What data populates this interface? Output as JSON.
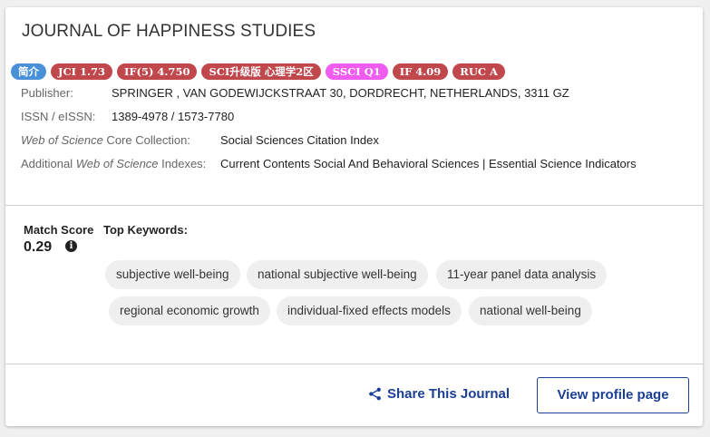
{
  "journal": {
    "title": "JOURNAL OF HAPPINESS STUDIES",
    "badges": [
      {
        "text": "简介",
        "color": "#4a90d9"
      },
      {
        "text": "JCI 1.73",
        "color": "#c0474b"
      },
      {
        "text": "IF(5) 4.750",
        "color": "#c0474b"
      },
      {
        "text": "SCI升级版 心理学2区",
        "color": "#c0474b"
      },
      {
        "text": "SSCI Q1",
        "color": "#f05bf0"
      },
      {
        "text": "IF 4.09",
        "color": "#c0474b"
      },
      {
        "text": "RUC A",
        "color": "#c0474b"
      }
    ],
    "publisher_label": "Publisher:",
    "publisher": "SPRINGER , VAN GODEWIJCKSTRAAT 30, DORDRECHT, NETHERLANDS, 3311 GZ",
    "issn_label": "ISSN / eISSN:",
    "issn": "1389-4978 / 1573-7780",
    "wos_label_italic": "Web of Science",
    "wos_label_rest": " Core Collection:",
    "wos": "Social Sciences Citation Index",
    "add_label_pre": "Additional ",
    "add_label_italic": "Web of Science",
    "add_label_post": " Indexes:",
    "additional": "Current Contents Social And Behavioral Sciences | Essential Science Indicators"
  },
  "match": {
    "label": "Match Score",
    "value": "0.29",
    "info_glyph": "i"
  },
  "keywords": {
    "label": "Top Keywords:",
    "items": [
      "subjective well-being",
      "national subjective well-being",
      "11-year panel data analysis",
      "regional economic growth",
      "individual-fixed effects models",
      "national well-being"
    ]
  },
  "actions": {
    "share": "Share This Journal",
    "profile": "View profile page"
  },
  "colors": {
    "link_blue": "#1a3f95"
  }
}
